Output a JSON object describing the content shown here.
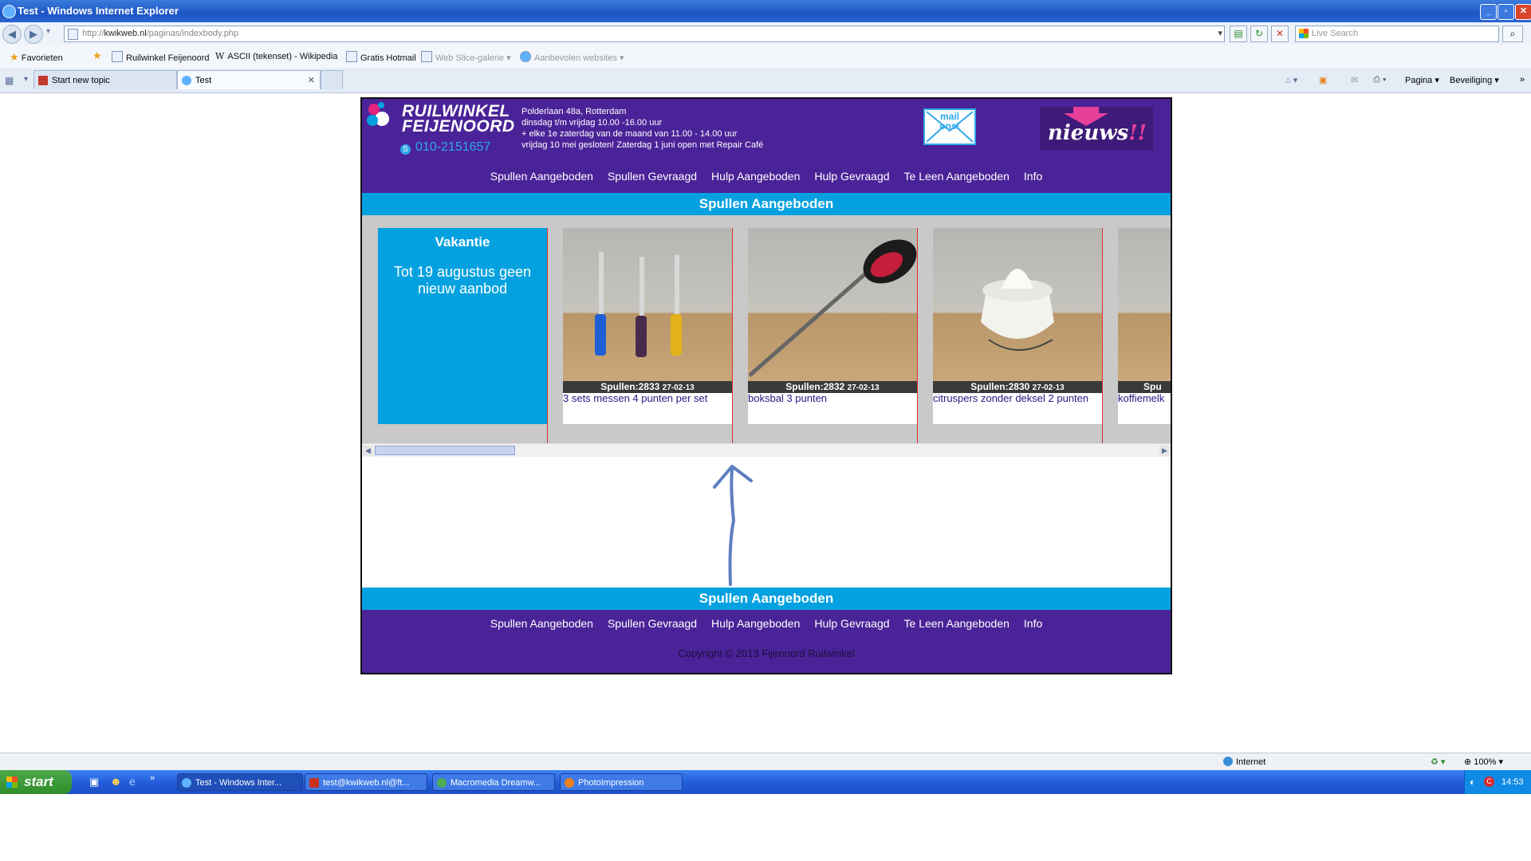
{
  "window": {
    "title": "Test - Windows Internet Explorer",
    "controls": {
      "minimize": "_",
      "restore": "▫",
      "close": "✕"
    }
  },
  "addressbar": {
    "url_prefix": "http://",
    "url_host": "kwikweb.nl",
    "url_path": "/paginas/indexbody.php",
    "search_placeholder": "Live Search"
  },
  "favorites": {
    "favorites_label": "Favorieten",
    "items": [
      "Ruilwinkel Feijenoord",
      "ASCII (tekenset) - Wikipedia",
      "Gratis Hotmail",
      "Web Slice-galerie",
      "Aanbevolen websites"
    ]
  },
  "tabs": [
    {
      "label": "Start new topic"
    },
    {
      "label": "Test"
    }
  ],
  "commandbar": {
    "page_label": "Pagina",
    "security_label": "Beveiliging"
  },
  "site": {
    "logo": {
      "line1": "RUILWINKEL",
      "line2": "FEIJENOORD"
    },
    "phone": "010-2151657",
    "address_lines": [
      "Polderlaan 48a, Rotterdam",
      "dinsdag t/m vrijdag 10.00 -16.00 uur",
      "+ elke 1e zaterdag van de maand van 11.00 - 14.00 uur",
      "vrijdag 10 mei gesloten! Zaterdag 1 juni open met Repair Café"
    ],
    "mail": {
      "line1": "mail",
      "line2": "ons!"
    },
    "news": {
      "word": "nieuws",
      "exclaim": "!!"
    },
    "nav": [
      "Spullen Aangeboden",
      "Spullen Gevraagd",
      "Hulp Aangeboden",
      "Hulp Gevraagd",
      "Te Leen Aangeboden",
      "Info"
    ],
    "section_title": "Spullen Aangeboden",
    "vacation": {
      "title": "Vakantie",
      "body": "Tot 19 augustus geen nieuw aanbod"
    },
    "items": [
      {
        "id": "Spullen:2833",
        "date": "27-02-13",
        "desc": "3 sets messen 4 punten per set"
      },
      {
        "id": "Spullen:2832",
        "date": "27-02-13",
        "desc": "boksbal 3 punten"
      },
      {
        "id": "Spullen:2830",
        "date": "27-02-13",
        "desc": "citruspers zonder deksel 2 punten"
      },
      {
        "id": "Spu",
        "date": "",
        "desc": "koffiemelk"
      }
    ],
    "footer_title": "Spullen Aangeboden",
    "copyright": "Copyright © 2013 Fijenoord Ruilwinkel"
  },
  "statusbar": {
    "zone": "Internet",
    "zoom": "100%"
  },
  "taskbar": {
    "start": "start",
    "tasks": [
      "Test - Windows Inter...",
      "test@kwikweb.nl@ft...",
      "Macromedia Dreamw...",
      "PhotoImpression"
    ],
    "clock": "14:53"
  }
}
